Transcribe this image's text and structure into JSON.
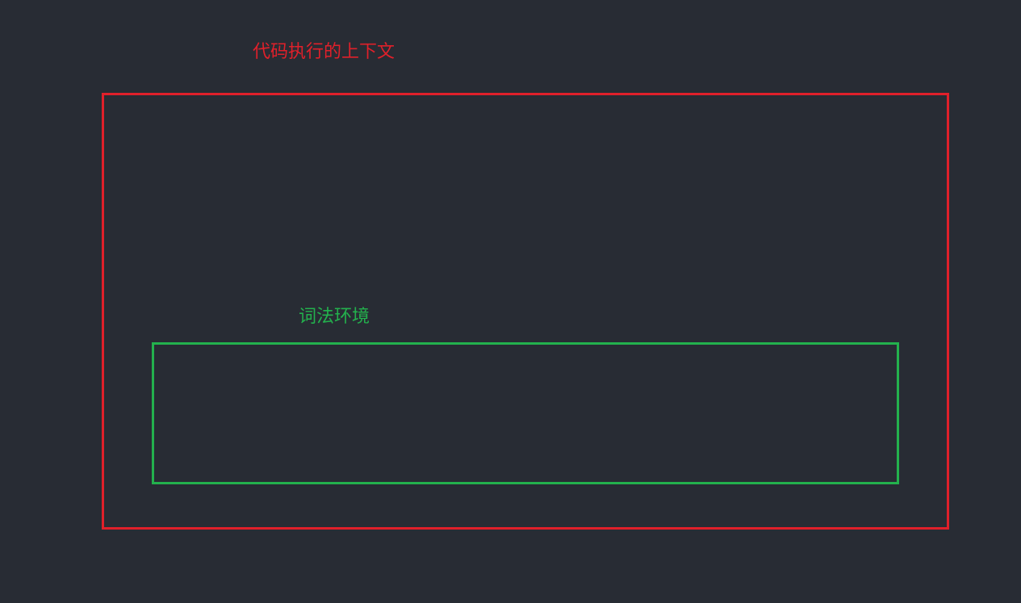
{
  "outer": {
    "title": "代码执行的上下文",
    "color": "#e0202a"
  },
  "inner": {
    "title": "词法环境",
    "color": "#23b14d"
  },
  "background": "#282c34"
}
